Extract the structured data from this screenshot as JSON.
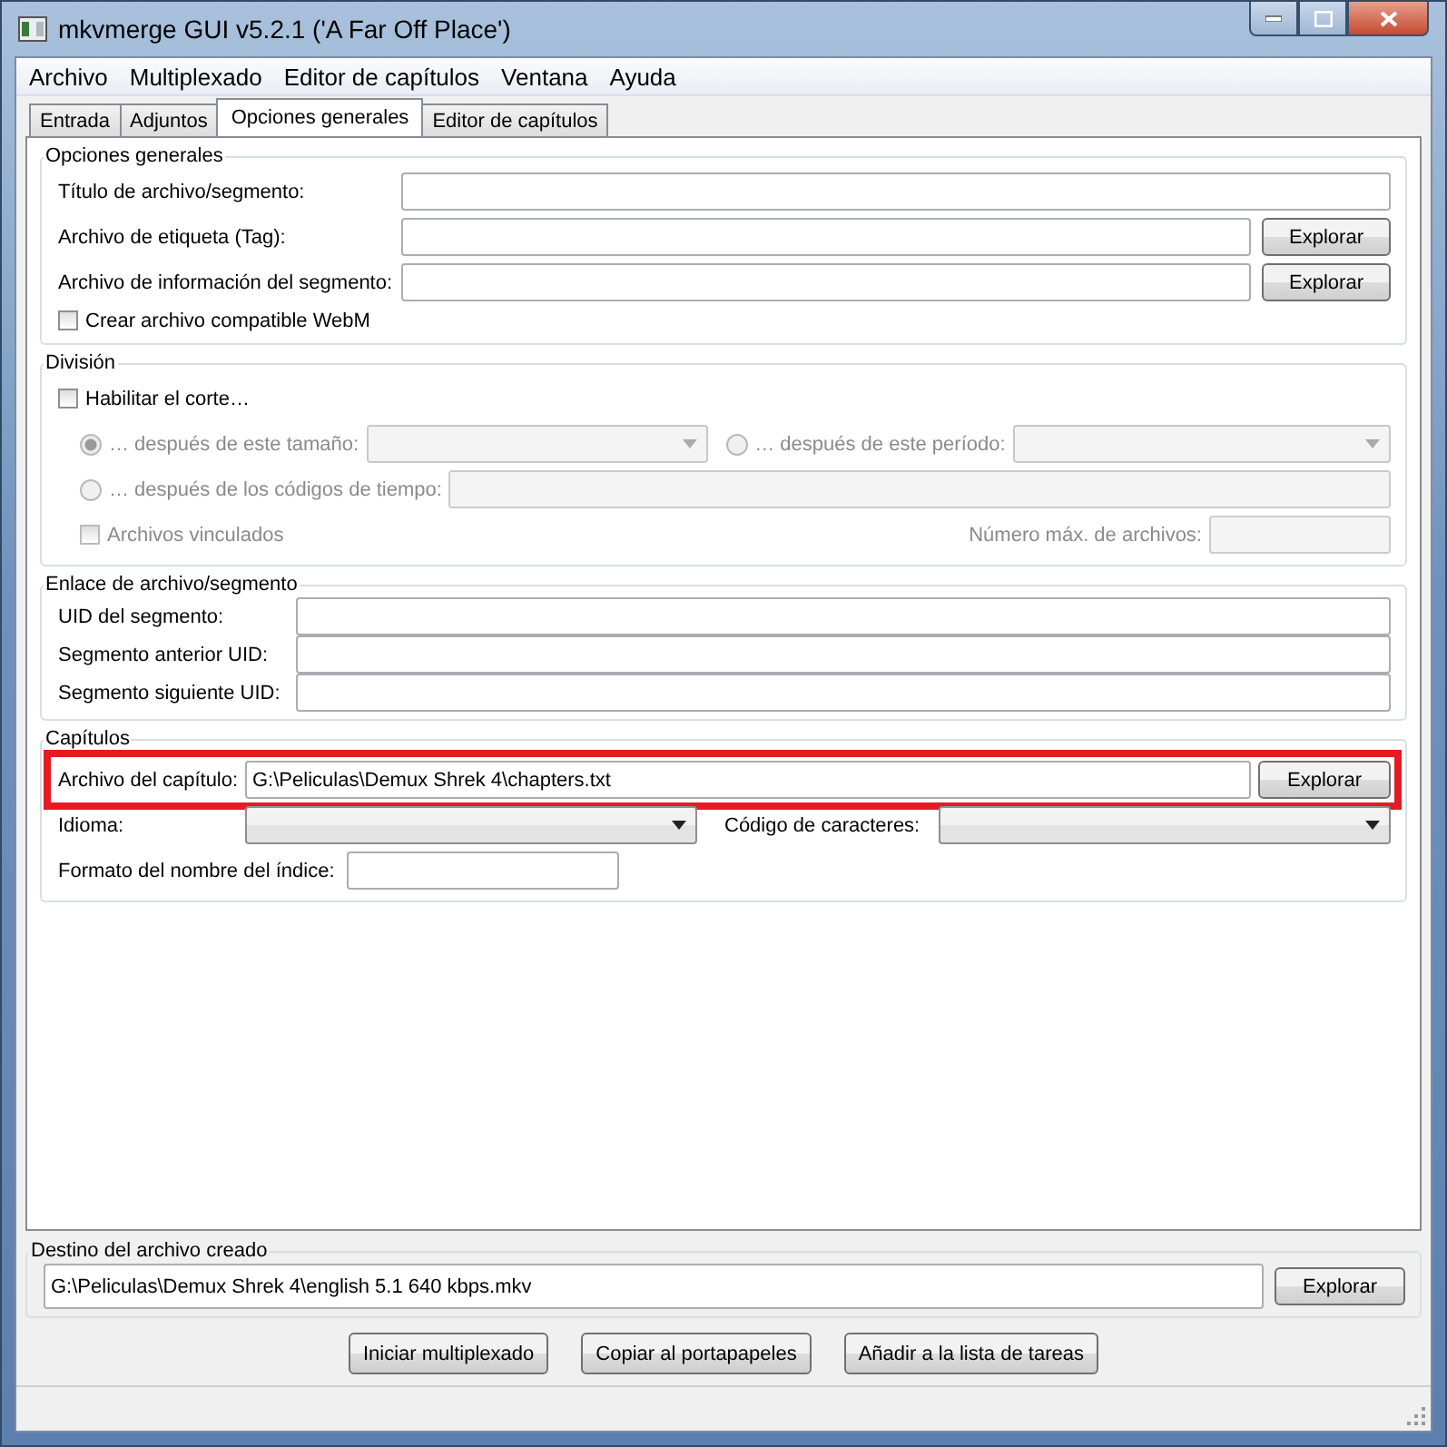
{
  "window": {
    "title": "mkvmerge GUI v5.2.1 ('A Far Off Place')"
  },
  "menu": [
    "Archivo",
    "Multiplexado",
    "Editor de capítulos",
    "Ventana",
    "Ayuda"
  ],
  "tabs": [
    {
      "label": "Entrada",
      "selected": false
    },
    {
      "label": "Adjuntos",
      "selected": false
    },
    {
      "label": "Opciones generales",
      "selected": true
    },
    {
      "label": "Editor de capítulos",
      "selected": false
    }
  ],
  "general": {
    "title": "Opciones generales",
    "fields": [
      {
        "label": "Título de archivo/segmento:"
      },
      {
        "label": "Archivo de etiqueta (Tag):",
        "button": "Explorar"
      },
      {
        "label": "Archivo de información del segmento:",
        "button": "Explorar"
      }
    ],
    "webm": {
      "label": "Crear archivo compatible WebM",
      "checked": false
    }
  },
  "split": {
    "title": "División",
    "enable": {
      "label": "Habilitar el corte…",
      "checked": false
    },
    "by_size": {
      "label": "… después de este tamaño:",
      "selected": true,
      "disabled": true
    },
    "by_duration": {
      "label": "… después de este período:",
      "selected": false,
      "disabled": true
    },
    "by_timecodes": {
      "label": "… después de los códigos de tiempo:",
      "selected": false,
      "disabled": true
    },
    "linked": {
      "label": "Archivos vinculados",
      "checked": false,
      "disabled": true
    },
    "max_files_label": "Número máx. de archivos:"
  },
  "linking": {
    "title": "Enlace de archivo/segmento",
    "fields": [
      {
        "label": "UID del segmento:"
      },
      {
        "label": "Segmento anterior UID:"
      },
      {
        "label": "Segmento siguiente UID:"
      }
    ]
  },
  "chapters": {
    "title": "Capítulos",
    "file": {
      "label": "Archivo del capítulo:",
      "value": "G:\\Peliculas\\Demux Shrek 4\\chapters.txt",
      "button": "Explorar",
      "highlighted": true
    },
    "language_label": "Idioma:",
    "charset_label": "Código de caracteres:",
    "cue_label": "Formato del nombre del índice:"
  },
  "output": {
    "title": "Destino del archivo creado",
    "value": "G:\\Peliculas\\Demux Shrek 4\\english 5.1 640 kbps.mkv",
    "button": "Explorar"
  },
  "actions": [
    "Iniciar multiplexado",
    "Copiar al portapapeles",
    "Añadir a la lista de tareas"
  ]
}
